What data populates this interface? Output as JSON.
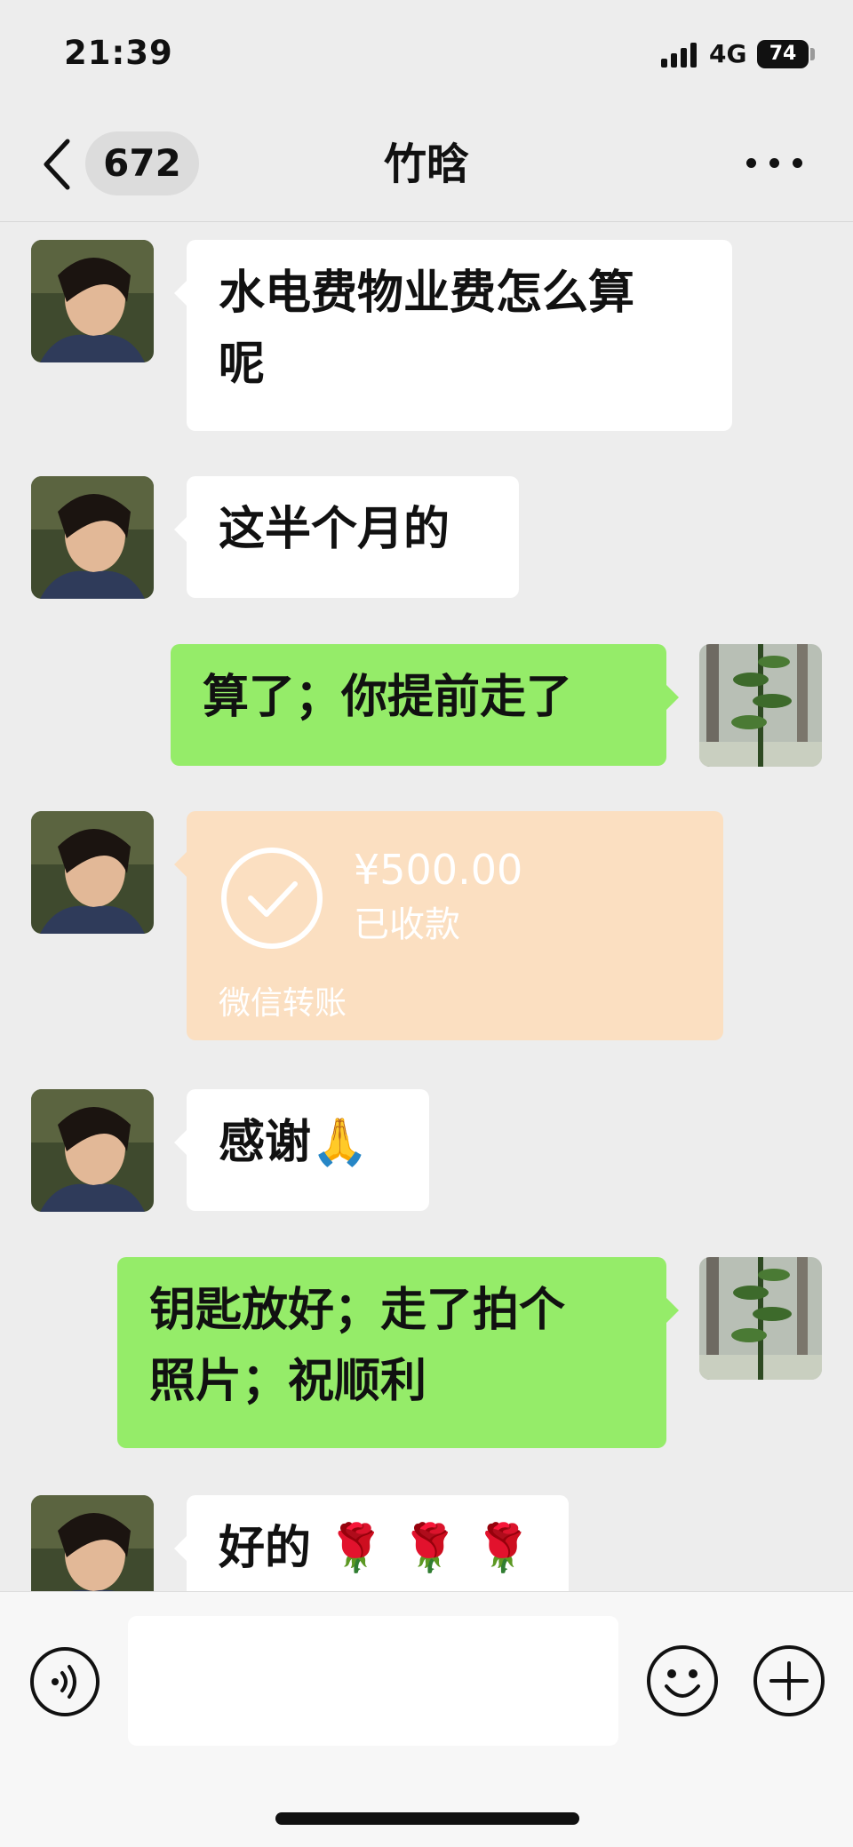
{
  "status_bar": {
    "time": "21:39",
    "network": "4G",
    "battery": "74"
  },
  "nav": {
    "unread_count": "672",
    "title": "竹晗"
  },
  "messages": [
    {
      "from": "contact",
      "lines": [
        "水电费物业费怎么算",
        "呢"
      ]
    },
    {
      "from": "contact",
      "lines": [
        "这半个月的"
      ]
    },
    {
      "from": "me",
      "lines": [
        "算了；你提前走了"
      ]
    },
    {
      "from": "contact",
      "type": "transfer",
      "amount": "¥500.00",
      "status": "已收款",
      "label": "微信转账"
    },
    {
      "from": "contact",
      "text": "感谢",
      "emoji": "🙏"
    },
    {
      "from": "me",
      "lines": [
        "钥匙放好；走了拍个",
        "照片；祝顺利"
      ]
    },
    {
      "from": "contact",
      "text": "好的",
      "emojis": [
        "🌹",
        "🌹",
        "🌹"
      ]
    }
  ],
  "colors": {
    "incoming_bubble": "#ffffff",
    "outgoing_bubble": "#95ec69",
    "transfer_card": "#fbdfc1",
    "background": "#ededed"
  },
  "icons": {
    "back": "chevron-left-icon",
    "more": "more-dots-icon",
    "voice": "voice-icon",
    "emoji": "smiley-icon",
    "plus": "plus-icon"
  }
}
